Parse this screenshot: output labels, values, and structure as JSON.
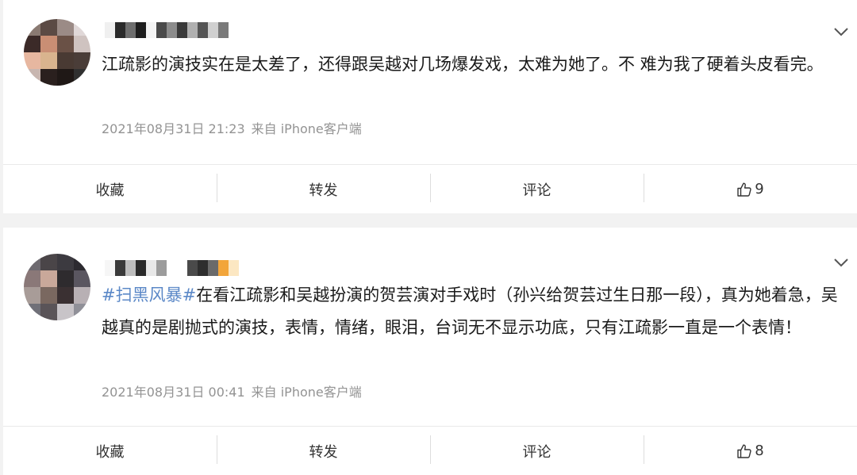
{
  "posts": [
    {
      "text_segments": [
        {
          "type": "text",
          "text": "江疏影的演技实在是太差了，还得跟吴越对几场爆发戏，太难为她了。不 难为我了硬着头皮看完。"
        }
      ],
      "date": "2021年08月31日 21:23",
      "source": "来自 iPhone客户端",
      "actions": {
        "collect": "收藏",
        "repost": "转发",
        "comment": "评论",
        "like_count": "9"
      },
      "avatar_colors": [
        "#8a7a72",
        "#5b4a44",
        "#9b8b86",
        "#e0d8d8",
        "#3b2a28",
        "#c98e74",
        "#6a5146",
        "#cfc3c0",
        "#e7b7a0",
        "#d9b48e",
        "#493a33",
        "#4a3d38",
        "#c8b6b0",
        "#2a201e",
        "#1f1816",
        "#303030"
      ],
      "name_colors": [
        "#f0f0f0",
        "#2a2a2a",
        "#6e6e6e",
        "#1e1e1e",
        "#f4f4f4",
        "#4a4a4a",
        "#8c8c8c",
        "#3a3a3a",
        "#b0b0b0",
        "#555555",
        "#d0d0d0",
        "#7a7a7a"
      ]
    },
    {
      "text_segments": [
        {
          "type": "hashtag",
          "text": "#扫黑风暴#"
        },
        {
          "type": "text",
          "text": "在看江疏影和吴越扮演的贺芸演对手戏时（孙兴给贺芸过生日那一段），真为她着急，吴越真的是剧抛式的演技，表情，情绪，眼泪，台词无不显示功底，只有江疏影一直是一个表情！"
        }
      ],
      "date": "2021年08月31日 00:41",
      "source": "来自 iPhone客户端",
      "actions": {
        "collect": "收藏",
        "repost": "转发",
        "comment": "评论",
        "like_count": "8"
      },
      "avatar_colors": [
        "#6e6a70",
        "#4a4548",
        "#3c3a40",
        "#2c2a30",
        "#8a7878",
        "#c9a89a",
        "#2e2b2e",
        "#5a5660",
        "#a89c98",
        "#7a6860",
        "#3a3032",
        "#b8b0b4",
        "#707078",
        "#5a5458",
        "#c8c4c8",
        "#909098"
      ],
      "name_colors": [
        "#f6f6f6",
        "#3a3a3a",
        "#bdbdbd",
        "#2a2a2a",
        "#e8e8e8",
        "#9c9c9c",
        "#ffffff",
        "#ffffff",
        "#4a4a4a",
        "#2e2e2e",
        "#6a6a6a",
        "#f2a53a",
        "#fce7c2"
      ]
    }
  ]
}
